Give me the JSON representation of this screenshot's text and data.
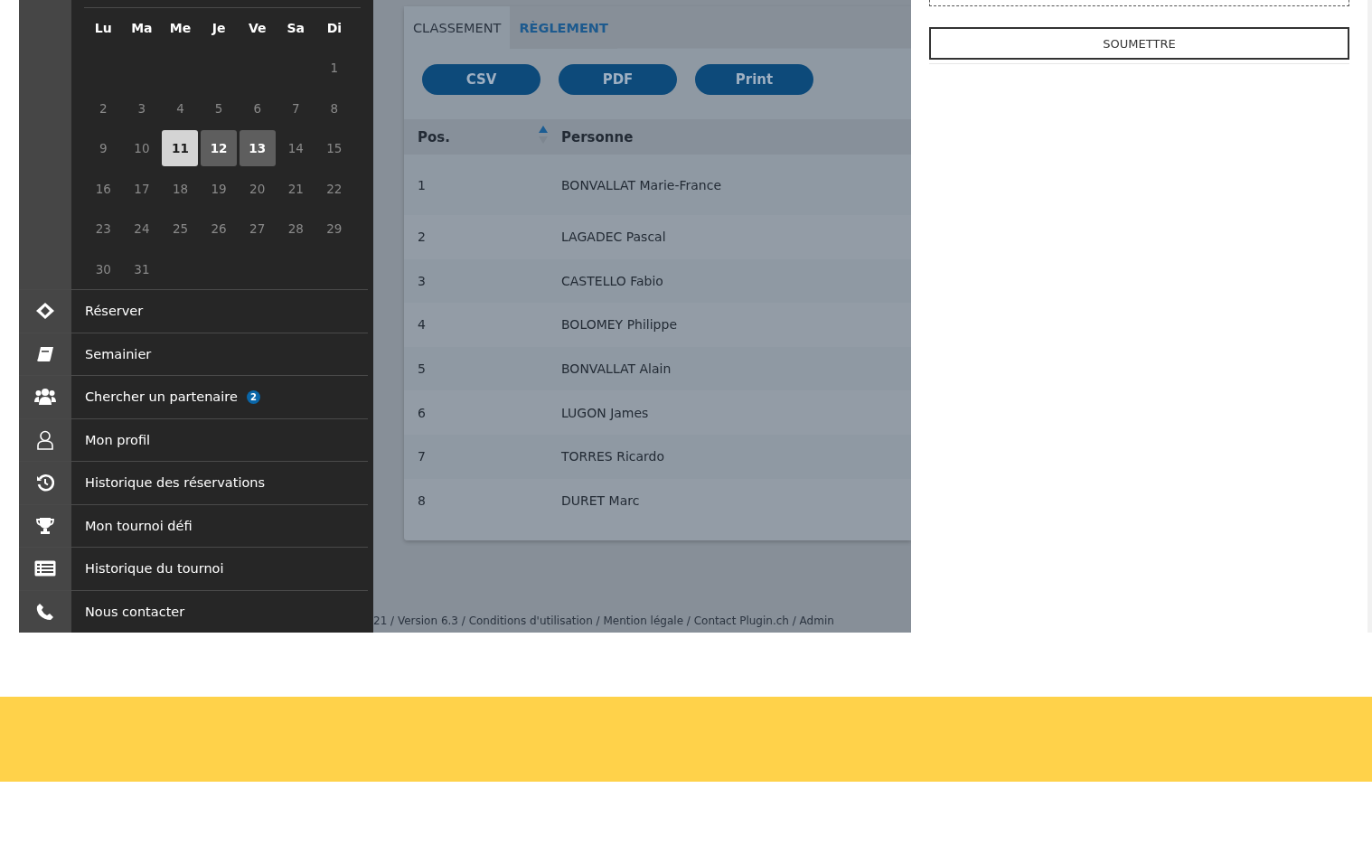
{
  "calendar": {
    "weekdays": [
      "Lu",
      "Ma",
      "Me",
      "Je",
      "Ve",
      "Sa",
      "Di"
    ],
    "weeks": [
      [
        {
          "label": "1",
          "selected": false,
          "in_range": false
        }
      ],
      [
        {
          "label": "2",
          "selected": false,
          "in_range": false
        },
        {
          "label": "3",
          "selected": false,
          "in_range": false
        },
        {
          "label": "4",
          "selected": false,
          "in_range": false
        },
        {
          "label": "5",
          "selected": false,
          "in_range": false
        },
        {
          "label": "6",
          "selected": false,
          "in_range": false
        },
        {
          "label": "7",
          "selected": false,
          "in_range": false
        },
        {
          "label": "8",
          "selected": false,
          "in_range": false
        }
      ],
      [
        {
          "label": "9",
          "selected": false,
          "in_range": false
        },
        {
          "label": "10",
          "selected": false,
          "in_range": false
        },
        {
          "label": "11",
          "selected": true,
          "in_range": false
        },
        {
          "label": "12",
          "selected": false,
          "in_range": true
        },
        {
          "label": "13",
          "selected": false,
          "in_range": true
        },
        {
          "label": "14",
          "selected": false,
          "in_range": false
        },
        {
          "label": "15",
          "selected": false,
          "in_range": false
        }
      ],
      [
        {
          "label": "16",
          "selected": false,
          "in_range": false
        },
        {
          "label": "17",
          "selected": false,
          "in_range": false
        },
        {
          "label": "18",
          "selected": false,
          "in_range": false
        },
        {
          "label": "19",
          "selected": false,
          "in_range": false
        },
        {
          "label": "20",
          "selected": false,
          "in_range": false
        },
        {
          "label": "21",
          "selected": false,
          "in_range": false
        },
        {
          "label": "22",
          "selected": false,
          "in_range": false
        }
      ],
      [
        {
          "label": "23",
          "selected": false,
          "in_range": false
        },
        {
          "label": "24",
          "selected": false,
          "in_range": false
        },
        {
          "label": "25",
          "selected": false,
          "in_range": false
        },
        {
          "label": "26",
          "selected": false,
          "in_range": false
        },
        {
          "label": "27",
          "selected": false,
          "in_range": false
        },
        {
          "label": "28",
          "selected": false,
          "in_range": false
        },
        {
          "label": "29",
          "selected": false,
          "in_range": false
        }
      ],
      [
        {
          "label": "30",
          "selected": false,
          "in_range": false
        },
        {
          "label": "31",
          "selected": false,
          "in_range": false
        }
      ]
    ]
  },
  "sidebar": {
    "items": [
      {
        "kind": "ticket",
        "label": "Réserver"
      },
      {
        "kind": "book",
        "label": "Semainier"
      },
      {
        "kind": "users",
        "label": "Chercher un partenaire",
        "badge": "2"
      },
      {
        "kind": "user",
        "label": "Mon profil"
      },
      {
        "kind": "history",
        "label": "Historique des réservations"
      },
      {
        "kind": "trophy",
        "label": "Mon tournoi défi"
      },
      {
        "kind": "list",
        "label": "Historique du tournoi"
      },
      {
        "kind": "phone",
        "label": "Nous contacter"
      }
    ]
  },
  "tabs": [
    {
      "label": "CLASSEMENT",
      "selected": true
    },
    {
      "label": "RÈGLEMENT",
      "selected": false
    }
  ],
  "export_buttons": [
    "CSV",
    "PDF",
    "Print"
  ],
  "table": {
    "columns": [
      "Pos.",
      "Personne"
    ],
    "rows": [
      [
        "1",
        "BONVALLAT Marie-France"
      ],
      [
        "2",
        "LAGADEC Pascal"
      ],
      [
        "3",
        "CASTELLO Fabio"
      ],
      [
        "4",
        "BOLOMEY Philippe"
      ],
      [
        "5",
        "BONVALLAT Alain"
      ],
      [
        "6",
        "LUGON James"
      ],
      [
        "7",
        "TORRES Ricardo"
      ],
      [
        "8",
        "DURET Marc"
      ]
    ]
  },
  "footer": "21 / Version 6.3 / Conditions d'utilisation / Mention légale / Contact Plugin.ch / Admin",
  "form": {
    "submit": "SOUMETTRE"
  }
}
